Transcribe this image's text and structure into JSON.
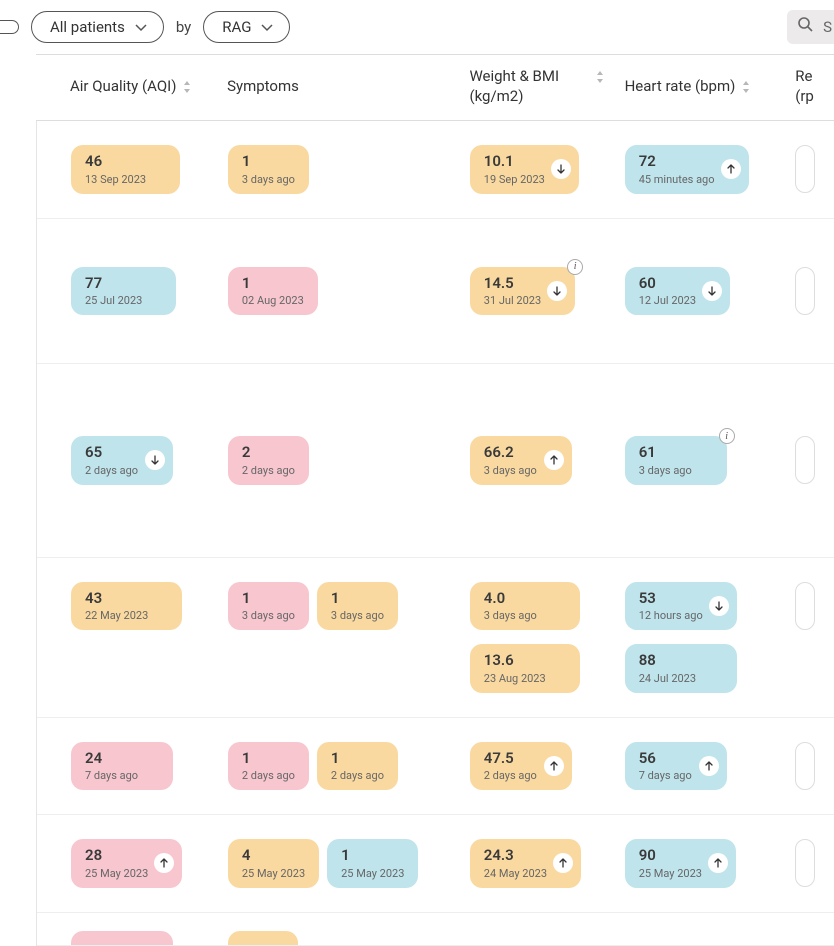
{
  "filters": {
    "patients_label": "All patients",
    "by_label": "by",
    "rag_label": "RAG",
    "search_placeholder": "S"
  },
  "columns": {
    "aqi": {
      "title": "Air Quality (AQI)"
    },
    "sym": {
      "title": "Symptoms"
    },
    "wt": {
      "title": "Weight & BMI (kg/m2)"
    },
    "hr": {
      "title": "Heart rate (bpm)"
    },
    "re": {
      "title": "Re",
      "sub": "(rp"
    }
  },
  "rows": [
    {
      "aqi": {
        "value": "46",
        "sub": "13 Sep 2023",
        "color": "orange"
      },
      "sym": [
        {
          "value": "1",
          "sub": "3 days ago",
          "color": "orange"
        }
      ],
      "wt": {
        "value": "10.1",
        "sub": "19 Sep 2023",
        "color": "orange",
        "trend": "down"
      },
      "hr": {
        "value": "72",
        "sub": "45 minutes ago",
        "color": "blue",
        "trend": "up"
      }
    },
    {
      "aqi": {
        "value": "77",
        "sub": "25 Jul 2023",
        "color": "blue"
      },
      "sym": [
        {
          "value": "1",
          "sub": "02 Aug 2023",
          "color": "pink"
        }
      ],
      "wt": {
        "value": "14.5",
        "sub": "31 Jul 2023",
        "color": "orange",
        "trend": "down",
        "info": true
      },
      "hr": {
        "value": "60",
        "sub": "12 Jul 2023",
        "color": "blue",
        "trend": "down"
      }
    },
    {
      "aqi": {
        "value": "65",
        "sub": "2 days ago",
        "color": "blue",
        "trend": "down"
      },
      "sym": [
        {
          "value": "2",
          "sub": "2 days ago",
          "color": "pink"
        }
      ],
      "wt": {
        "value": "66.2",
        "sub": "3 days ago",
        "color": "orange",
        "trend": "up"
      },
      "hr": {
        "value": "61",
        "sub": "3 days ago",
        "color": "blue",
        "info": true
      }
    },
    {
      "stack": true,
      "aqi": {
        "value": "43",
        "sub": "22 May 2023",
        "color": "orange"
      },
      "sym": [
        {
          "value": "1",
          "sub": "3 days ago",
          "color": "pink"
        },
        {
          "value": "1",
          "sub": "3 days ago",
          "color": "orange"
        }
      ],
      "wt_stack": [
        {
          "value": "4.0",
          "sub": "3 days ago",
          "color": "orange"
        },
        {
          "value": "13.6",
          "sub": "23 Aug 2023",
          "color": "orange"
        }
      ],
      "hr_stack": [
        {
          "value": "53",
          "sub": "12 hours ago",
          "color": "blue",
          "trend": "down"
        },
        {
          "value": "88",
          "sub": "24 Jul 2023",
          "color": "blue"
        }
      ]
    },
    {
      "aqi": {
        "value": "24",
        "sub": "7 days ago",
        "color": "pink"
      },
      "sym": [
        {
          "value": "1",
          "sub": "2 days ago",
          "color": "pink"
        },
        {
          "value": "1",
          "sub": "2 days ago",
          "color": "orange"
        }
      ],
      "wt": {
        "value": "47.5",
        "sub": "2 days ago",
        "color": "orange",
        "trend": "up"
      },
      "hr": {
        "value": "56",
        "sub": "7 days ago",
        "color": "blue",
        "trend": "up"
      }
    },
    {
      "aqi": {
        "value": "28",
        "sub": "25 May 2023",
        "color": "pink",
        "trend": "up"
      },
      "sym": [
        {
          "value": "4",
          "sub": "25 May 2023",
          "color": "orange"
        },
        {
          "value": "1",
          "sub": "25 May 2023",
          "color": "blue"
        }
      ],
      "wt": {
        "value": "24.3",
        "sub": "24 May 2023",
        "color": "orange",
        "trend": "up"
      },
      "hr": {
        "value": "90",
        "sub": "25 May 2023",
        "color": "blue",
        "trend": "up"
      }
    }
  ]
}
